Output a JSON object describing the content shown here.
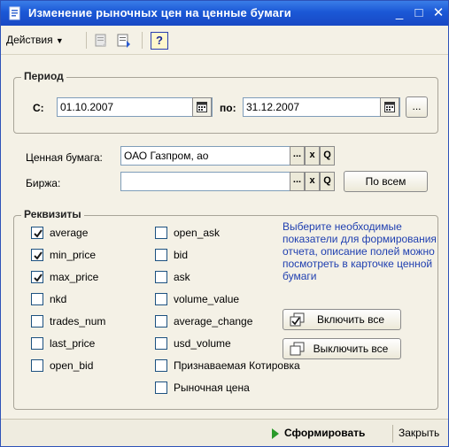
{
  "window": {
    "title": "Изменение рыночных цен на ценные бумаги"
  },
  "toolbar": {
    "actions_label": "Действия",
    "help_label": "?"
  },
  "period": {
    "legend": "Период",
    "from_label": "С:",
    "from_value": "01.10.2007",
    "to_label": "по:",
    "to_value": "31.12.2007",
    "more_label": "..."
  },
  "security": {
    "label": "Ценная бумага:",
    "value": "ОАО Газпром, ао"
  },
  "exchange": {
    "label": "Биржа:",
    "value": "",
    "all_button": "По всем"
  },
  "field_buttons": {
    "select": "...",
    "clear": "x",
    "search": "Q"
  },
  "requisites": {
    "legend": "Реквизиты",
    "col1": [
      {
        "label": "average",
        "checked": true
      },
      {
        "label": "min_price",
        "checked": true
      },
      {
        "label": "max_price",
        "checked": true
      },
      {
        "label": "nkd",
        "checked": false
      },
      {
        "label": "trades_num",
        "checked": false
      },
      {
        "label": "last_price",
        "checked": false
      },
      {
        "label": "open_bid",
        "checked": false
      }
    ],
    "col2": [
      {
        "label": "open_ask",
        "checked": false
      },
      {
        "label": "bid",
        "checked": false
      },
      {
        "label": "ask",
        "checked": false
      },
      {
        "label": "volume_value",
        "checked": false
      },
      {
        "label": "average_change",
        "checked": false
      },
      {
        "label": "usd_volume",
        "checked": false
      },
      {
        "label": "Признаваемая Котировка",
        "checked": false
      },
      {
        "label": "Рыночная цена",
        "checked": false
      }
    ],
    "hint": "Выберите необходимые показатели для формирования отчета, описание полей можно посмотреть в карточке ценной бумаги",
    "enable_all": "Включить все",
    "disable_all": "Выключить все"
  },
  "footer": {
    "generate": "Сформировать",
    "close": "Закрыть"
  }
}
